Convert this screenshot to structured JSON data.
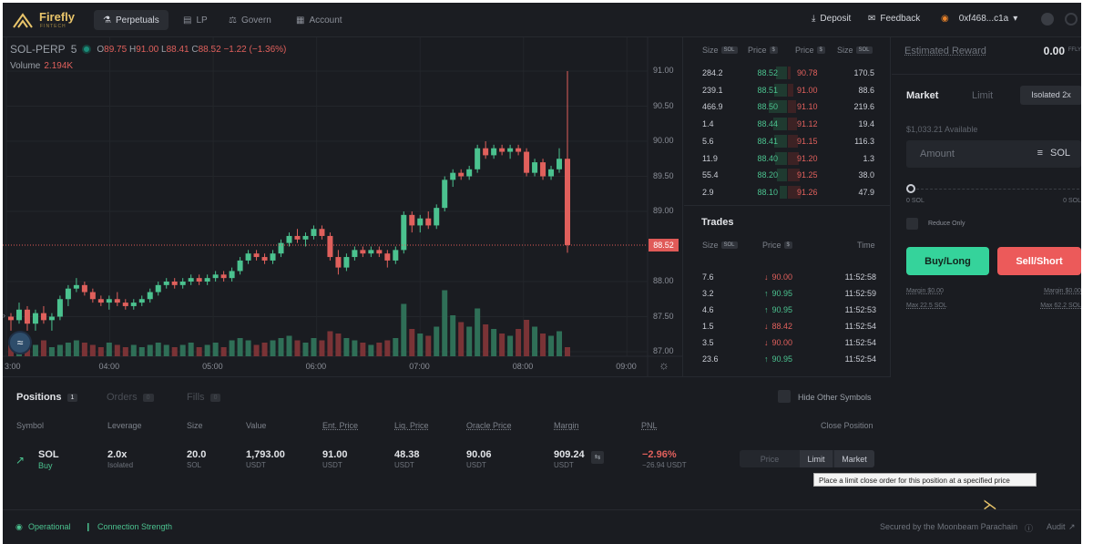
{
  "header": {
    "logo_text": "Firefly",
    "logo_sub": "FINTECH",
    "nav": [
      {
        "label": "Perpetuals",
        "icon": "perpetuals-icon",
        "active": true
      },
      {
        "label": "LP",
        "icon": "lp-icon",
        "active": false
      },
      {
        "label": "Govern",
        "icon": "govern-icon",
        "active": false
      },
      {
        "label": "Account",
        "icon": "account-icon",
        "active": false
      }
    ],
    "deposit": "Deposit",
    "feedback": "Feedback",
    "wallet": "0xf468...c1a"
  },
  "market": {
    "symbol": "SOL-PERP",
    "interval": "5",
    "open_label": "O",
    "open": "89.75",
    "high_label": "H",
    "high": "91.00",
    "low_label": "L",
    "low": "88.41",
    "close_label": "C",
    "close": "88.52",
    "change": "−1.22 (−1.36%)",
    "volume_label": "Volume",
    "volume": "2.194K",
    "last_price": "88.52"
  },
  "chart_data": {
    "type": "candlestick",
    "y_ticks": [
      "91.00",
      "90.50",
      "90.00",
      "89.50",
      "89.00",
      "88.00",
      "87.50",
      "87.00"
    ],
    "y_tick_values": [
      91.0,
      90.5,
      90.0,
      89.5,
      89.0,
      88.0,
      87.5,
      87.0
    ],
    "x_ticks": [
      "3:00",
      "04:00",
      "05:00",
      "06:00",
      "07:00",
      "08:00",
      "09:00"
    ],
    "x_tick_hours": [
      3,
      4,
      5,
      6,
      7,
      8,
      9
    ],
    "ylim": [
      86.9,
      91.2
    ],
    "x_start_hour": 3.0,
    "x_end_hour": 9.2,
    "candles": [
      [
        87.5,
        87.55,
        87.3,
        87.45,
        0.5
      ],
      [
        87.45,
        87.7,
        87.4,
        87.6,
        0.6
      ],
      [
        87.6,
        87.65,
        87.3,
        87.4,
        0.4
      ],
      [
        87.4,
        87.6,
        87.3,
        87.55,
        0.5
      ],
      [
        87.55,
        87.65,
        87.4,
        87.45,
        0.7
      ],
      [
        87.45,
        87.55,
        87.3,
        87.5,
        0.4
      ],
      [
        87.5,
        87.8,
        87.45,
        87.75,
        0.5
      ],
      [
        87.75,
        87.95,
        87.65,
        87.9,
        0.6
      ],
      [
        87.9,
        88.05,
        87.85,
        87.95,
        0.7
      ],
      [
        87.95,
        88.0,
        87.8,
        87.85,
        0.6
      ],
      [
        87.85,
        87.9,
        87.7,
        87.75,
        0.5
      ],
      [
        87.75,
        87.8,
        87.65,
        87.7,
        0.4
      ],
      [
        87.7,
        87.8,
        87.6,
        87.75,
        0.6
      ],
      [
        87.75,
        87.85,
        87.65,
        87.7,
        0.5
      ],
      [
        87.7,
        87.75,
        87.6,
        87.65,
        0.4
      ],
      [
        87.65,
        87.75,
        87.6,
        87.7,
        0.5
      ],
      [
        87.7,
        87.8,
        87.65,
        87.75,
        0.4
      ],
      [
        87.75,
        87.9,
        87.7,
        87.85,
        0.5
      ],
      [
        87.85,
        88.0,
        87.8,
        87.95,
        0.6
      ],
      [
        87.95,
        88.05,
        87.9,
        88.0,
        0.5
      ],
      [
        88.0,
        88.05,
        87.9,
        87.95,
        0.4
      ],
      [
        87.95,
        88.05,
        87.9,
        88.0,
        0.5
      ],
      [
        88.0,
        88.1,
        87.95,
        88.05,
        0.6
      ],
      [
        88.05,
        88.1,
        87.95,
        88.0,
        0.4
      ],
      [
        88.0,
        88.1,
        87.95,
        88.05,
        0.5
      ],
      [
        88.05,
        88.15,
        88.0,
        88.1,
        0.6
      ],
      [
        88.1,
        88.15,
        88.0,
        88.05,
        0.4
      ],
      [
        88.05,
        88.2,
        88.0,
        88.15,
        0.7
      ],
      [
        88.15,
        88.35,
        88.1,
        88.3,
        0.8
      ],
      [
        88.3,
        88.45,
        88.25,
        88.4,
        0.7
      ],
      [
        88.4,
        88.45,
        88.3,
        88.35,
        0.5
      ],
      [
        88.35,
        88.4,
        88.25,
        88.3,
        0.6
      ],
      [
        88.3,
        88.45,
        88.25,
        88.4,
        0.7
      ],
      [
        88.4,
        88.6,
        88.35,
        88.55,
        0.8
      ],
      [
        88.55,
        88.7,
        88.5,
        88.65,
        0.9
      ],
      [
        88.65,
        88.75,
        88.55,
        88.6,
        0.7
      ],
      [
        88.6,
        88.7,
        88.5,
        88.65,
        0.6
      ],
      [
        88.65,
        88.8,
        88.6,
        88.75,
        0.8
      ],
      [
        88.75,
        88.8,
        88.6,
        88.65,
        0.7
      ],
      [
        88.65,
        88.7,
        88.3,
        88.35,
        1.1
      ],
      [
        88.35,
        88.45,
        88.1,
        88.2,
        1.0
      ],
      [
        88.2,
        88.4,
        88.15,
        88.35,
        0.8
      ],
      [
        88.35,
        88.5,
        88.3,
        88.45,
        0.7
      ],
      [
        88.45,
        88.5,
        88.35,
        88.4,
        0.6
      ],
      [
        88.4,
        88.5,
        88.35,
        88.45,
        0.5
      ],
      [
        88.45,
        88.5,
        88.35,
        88.4,
        0.6
      ],
      [
        88.4,
        88.45,
        88.2,
        88.3,
        0.7
      ],
      [
        88.3,
        88.5,
        88.25,
        88.45,
        0.8
      ],
      [
        88.45,
        89.0,
        88.4,
        88.95,
        2.3
      ],
      [
        88.95,
        89.0,
        88.7,
        88.8,
        1.2
      ],
      [
        88.8,
        88.95,
        88.7,
        88.9,
        1.0
      ],
      [
        88.9,
        89.0,
        88.75,
        88.8,
        0.9
      ],
      [
        88.8,
        89.1,
        88.75,
        89.05,
        1.3
      ],
      [
        89.05,
        89.5,
        89.0,
        89.45,
        2.9
      ],
      [
        89.45,
        89.6,
        89.35,
        89.55,
        1.8
      ],
      [
        89.55,
        89.6,
        89.45,
        89.5,
        1.5
      ],
      [
        89.5,
        89.65,
        89.45,
        89.6,
        1.3
      ],
      [
        89.6,
        89.95,
        89.55,
        89.9,
        2.1
      ],
      [
        89.9,
        90.0,
        89.75,
        89.8,
        1.4
      ],
      [
        89.8,
        89.95,
        89.75,
        89.9,
        1.2
      ],
      [
        89.9,
        89.95,
        89.8,
        89.85,
        1.0
      ],
      [
        89.85,
        89.95,
        89.75,
        89.9,
        0.9
      ],
      [
        89.9,
        89.95,
        89.8,
        89.85,
        1.2
      ],
      [
        89.85,
        89.9,
        89.5,
        89.55,
        1.6
      ],
      [
        89.55,
        89.75,
        89.5,
        89.7,
        1.3
      ],
      [
        89.7,
        89.75,
        89.45,
        89.5,
        1.0
      ],
      [
        89.5,
        89.65,
        89.45,
        89.6,
        0.9
      ],
      [
        89.6,
        89.9,
        89.55,
        89.75,
        1.1
      ],
      [
        89.75,
        91.0,
        88.41,
        88.52,
        0.4
      ]
    ]
  },
  "orderbook": {
    "headers": {
      "size_label": "Size",
      "price_label": "Price",
      "sol_badge": "SOL",
      "usd_badge": "$"
    },
    "rows": [
      {
        "bid_size": "284.2",
        "bid_price": "88.52",
        "ask_price": "90.78",
        "ask_size": "170.5"
      },
      {
        "bid_size": "239.1",
        "bid_price": "88.51",
        "ask_price": "91.00",
        "ask_size": "88.6"
      },
      {
        "bid_size": "466.9",
        "bid_price": "88.50",
        "ask_price": "91.10",
        "ask_size": "219.6"
      },
      {
        "bid_size": "1.4",
        "bid_price": "88.44",
        "ask_price": "91.12",
        "ask_size": "19.4"
      },
      {
        "bid_size": "5.6",
        "bid_price": "88.41",
        "ask_price": "91.15",
        "ask_size": "116.3"
      },
      {
        "bid_size": "11.9",
        "bid_price": "88.40",
        "ask_price": "91.20",
        "ask_size": "1.3"
      },
      {
        "bid_size": "55.4",
        "bid_price": "88.20",
        "ask_price": "91.25",
        "ask_size": "38.0"
      },
      {
        "bid_size": "2.9",
        "bid_price": "88.10",
        "ask_price": "91.26",
        "ask_size": "47.9"
      }
    ],
    "bid_depth": [
      0.6,
      0.7,
      1.0,
      0.75,
      0.7,
      0.65,
      0.55,
      0.4
    ],
    "ask_depth": [
      0.15,
      0.3,
      0.45,
      0.5,
      0.55,
      0.6,
      0.65,
      0.7
    ]
  },
  "trades": {
    "title": "Trades",
    "size_label": "Size",
    "price_label": "Price",
    "time_label": "Time",
    "sol_badge": "SOL",
    "usd_badge": "$",
    "rows": [
      {
        "size": "7.6",
        "price": "90.00",
        "dir": "down",
        "time": "11:52:58"
      },
      {
        "size": "3.2",
        "price": "90.95",
        "dir": "up",
        "time": "11:52:59"
      },
      {
        "size": "4.6",
        "price": "90.95",
        "dir": "up",
        "time": "11:52:53"
      },
      {
        "size": "1.5",
        "price": "88.42",
        "dir": "down",
        "time": "11:52:54"
      },
      {
        "size": "3.5",
        "price": "90.00",
        "dir": "down",
        "time": "11:52:54"
      },
      {
        "size": "23.6",
        "price": "90.95",
        "dir": "up",
        "time": "11:52:54"
      }
    ]
  },
  "trade_panel": {
    "est_label": "Estimated Reward",
    "est_value": "0.00",
    "est_unit": "FFLY",
    "tab_market": "Market",
    "tab_limit": "Limit",
    "isolated": "Isolated 2x",
    "available": "$1,033.21 Available",
    "amount_placeholder": "Amount",
    "amount_unit": "SOL",
    "slider_min": "0 SOL",
    "slider_max": "0 SOL",
    "slider_value": 0,
    "reduce_only": "Reduce Only",
    "buy_label": "Buy/Long",
    "sell_label": "Sell/Short",
    "margin_left": "Margin $0.00",
    "margin_right": "Margin $0.00",
    "max_left": "Max 22.5 SOL",
    "max_right": "Max 62.2 SOL"
  },
  "positions": {
    "tabs": [
      {
        "label": "Positions",
        "count": "1",
        "active": true
      },
      {
        "label": "Orders",
        "count": "0",
        "active": false
      },
      {
        "label": "Fills",
        "count": "0",
        "active": false
      }
    ],
    "hide_other": "Hide Other Symbols",
    "headers": [
      "Symbol",
      "Leverage",
      "Size",
      "Value",
      "Ent. Price",
      "Liq. Price",
      "Oracle Price",
      "Margin",
      "PNL",
      "Close Position"
    ],
    "row": {
      "symbol": "SOL",
      "side": "Buy",
      "leverage": "2.0x",
      "leverage_sub": "Isolated",
      "size": "20.0",
      "size_sub": "SOL",
      "value": "1,793.00",
      "value_sub": "USDT",
      "entry": "91.00",
      "entry_sub": "USDT",
      "liq": "48.38",
      "liq_sub": "USDT",
      "oracle": "90.06",
      "oracle_sub": "USDT",
      "margin": "909.24",
      "margin_sub": "USDT",
      "pnl": "−2.96%",
      "pnl_sub": "−26.94  USDT"
    },
    "close_price_placeholder": "Price",
    "limit_label": "Limit",
    "market_label": "Market",
    "tooltip": "Place a limit close order for this position at a specified price"
  },
  "footer": {
    "operational": "Operational",
    "connection": "Connection Strength",
    "secured": "Secured by the Moonbeam Parachain",
    "audit": "Audit"
  },
  "colors": {
    "up": "#4bc28f",
    "down": "#e0605c",
    "buy": "#35d39b",
    "sell": "#ec5a5a",
    "brand": "#e8c46a"
  }
}
